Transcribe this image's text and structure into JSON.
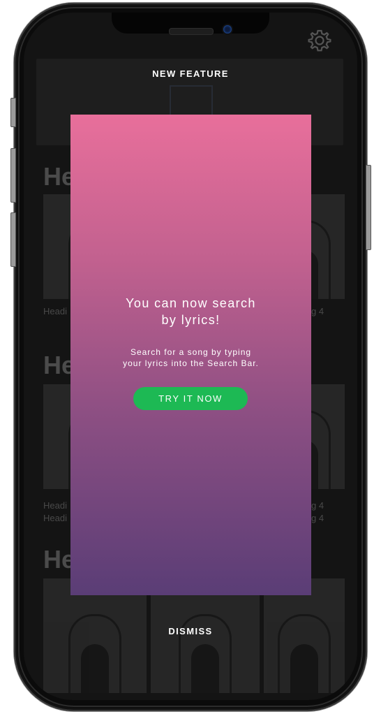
{
  "header": {
    "title": "NEW FEATURE"
  },
  "modal": {
    "title_line1": "You can now search",
    "title_line2": "by lyrics!",
    "subtitle_line1": "Search for a song by typing",
    "subtitle_line2": "your lyrics into the Search Bar.",
    "cta_label": "TRY IT NOW"
  },
  "footer": {
    "dismiss_label": "DISMISS"
  },
  "background": {
    "sections": [
      {
        "title": "He",
        "label_left": "Headi",
        "label_right": "g 4"
      },
      {
        "title": "He",
        "label_left": "Headi",
        "label_right": "g 4",
        "sub_left": "Headi",
        "sub_right": "g 4"
      },
      {
        "title": "He"
      }
    ]
  },
  "icons": {
    "settings": "gear-icon",
    "banner_image": "image-placeholder-icon"
  },
  "colors": {
    "modal_top": "#e86f9b",
    "modal_bottom": "#5a3d76",
    "cta": "#1db954",
    "screen_bg": "#141414"
  }
}
